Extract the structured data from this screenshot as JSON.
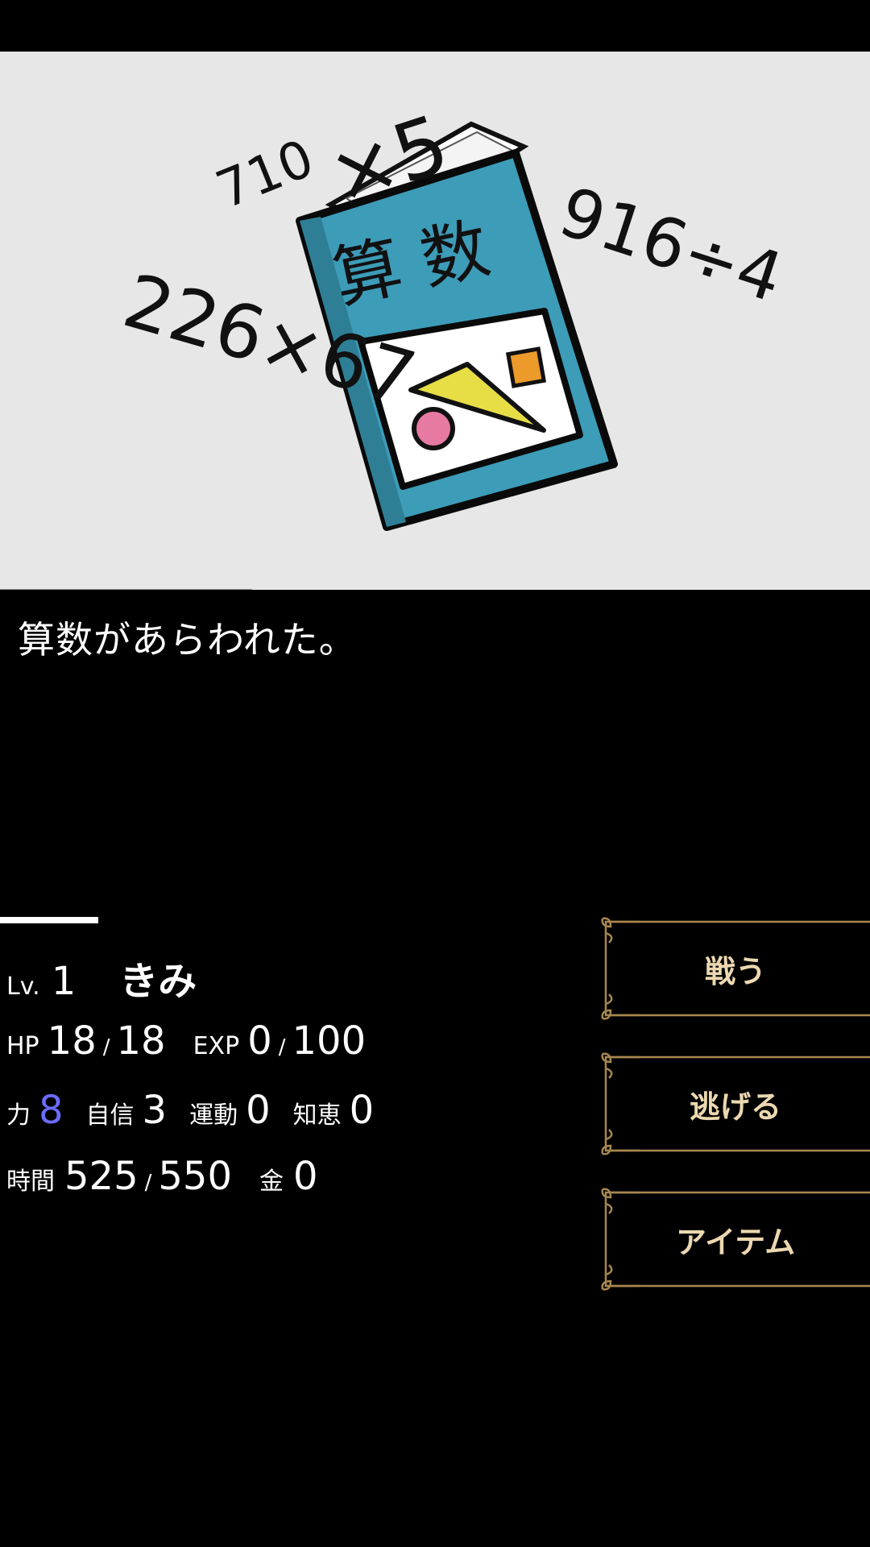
{
  "scene": {
    "enemy_hp_fraction": 0.29,
    "doodle_numbers": [
      "710",
      "×5",
      "916÷4",
      "226×67"
    ],
    "book_title": "算 数"
  },
  "message": "算数があらわれた。",
  "status": {
    "lv_label": "Lv.",
    "lv_value": "1",
    "name": "きみ",
    "hp_label": "HP",
    "hp_current": "18",
    "hp_max": "18",
    "exp_label": "EXP",
    "exp_current": "0",
    "exp_max": "100",
    "slash": "/",
    "str_label": "力",
    "str_value": "8",
    "conf_label": "自信",
    "conf_value": "3",
    "exercise_label": "運動",
    "exercise_value": "0",
    "wisdom_label": "知恵",
    "wisdom_value": "0",
    "time_label": "時間",
    "time_current": "525",
    "time_max": "550",
    "money_label": "金",
    "money_value": "0"
  },
  "commands": {
    "fight": "戦う",
    "flee": "逃げる",
    "item": "アイテム"
  },
  "colors": {
    "background": "#000000",
    "scene_bg": "#e7e7e7",
    "book": "#3d9cb8",
    "button_text": "#ecd8b0",
    "button_border": "#a8874f",
    "strength_value": "#6b6bff"
  }
}
